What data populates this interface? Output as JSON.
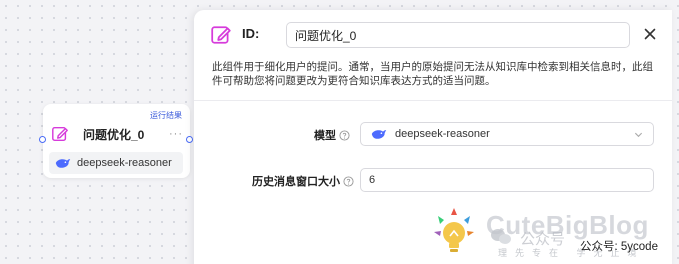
{
  "node": {
    "run_result": "运行结果",
    "title": "问题优化_0",
    "more": "···",
    "model": "deepseek-reasoner"
  },
  "panel": {
    "id_label": "ID:",
    "id_value": "问题优化_0",
    "description": "此组件用于细化用户的提问。通常，当用户的原始提问无法从知识库中检索到相关信息时，此组件可帮助您将问题更改为更符合知识库表达方式的适当问题。",
    "model_label": "模型",
    "model_value": "deepseek-reasoner",
    "history_label": "历史消息窗口大小",
    "history_value": "6"
  },
  "watermark": {
    "brand": "CuteBigBlog",
    "tagline": "理先专在 学无止境",
    "ghost_text": "公众号",
    "account": "公众号: 5ycode"
  },
  "colors": {
    "accent": "#d63bdb",
    "model_icon": "#4d6bfe",
    "handle": "#4a6cf7"
  },
  "icons": [
    "edit-icon",
    "deepseek-whale-icon",
    "close-icon",
    "help-icon",
    "chevron-down-icon",
    "bulb-logo-icon",
    "wechat-icon"
  ]
}
